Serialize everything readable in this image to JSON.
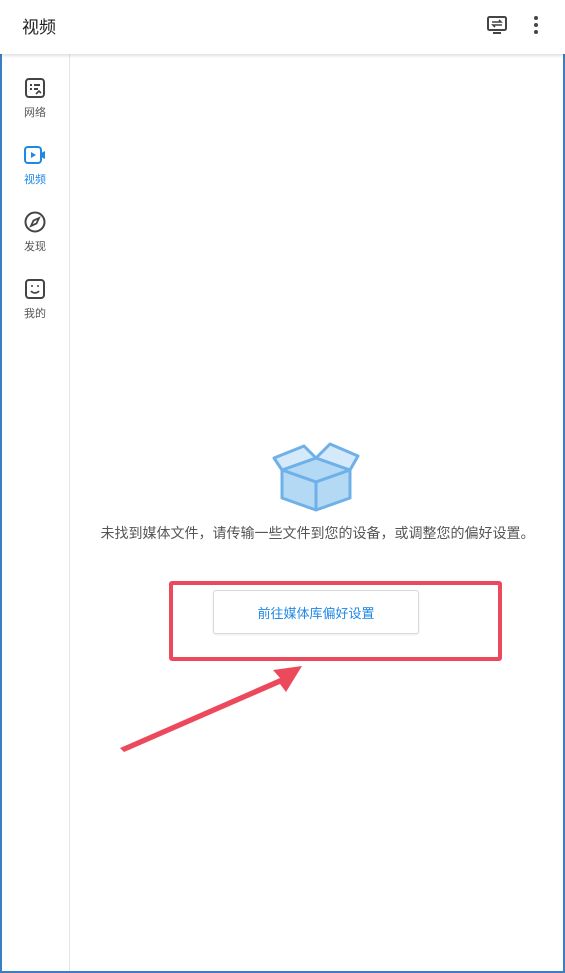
{
  "header": {
    "title": "视频",
    "cast_icon": "cast-icon",
    "more_icon": "more-vert-icon"
  },
  "sidebar": {
    "items": [
      {
        "label": "网络",
        "icon": "network-icon",
        "active": false
      },
      {
        "label": "视频",
        "icon": "video-icon",
        "active": true
      },
      {
        "label": "发现",
        "icon": "compass-icon",
        "active": false
      },
      {
        "label": "我的",
        "icon": "smiley-icon",
        "active": false
      }
    ]
  },
  "main": {
    "empty_icon": "empty-box-icon",
    "empty_message": "未找到媒体文件，请传输一些文件到您的设备，或调整您的偏好设置。",
    "button_label": "前往媒体库偏好设置"
  },
  "colors": {
    "accent": "#1e88e5",
    "highlight": "#ec4a5c",
    "box_fill": "#b3d9f5",
    "box_stroke": "#6fb0e8"
  }
}
